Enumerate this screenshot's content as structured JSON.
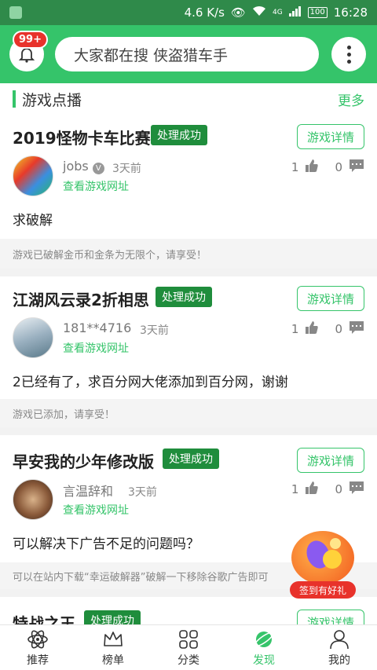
{
  "status_bar": {
    "speed": "4.6 K/s",
    "signal": "4G",
    "battery": "100",
    "time": "16:28"
  },
  "header": {
    "badge": "99+",
    "search_placeholder": "大家都在搜  侠盗猎车手"
  },
  "section": {
    "title": "游戏点播",
    "more": "更多"
  },
  "cards": [
    {
      "game": "2019怪物卡车比赛",
      "status": "处理成功",
      "detail": "游戏详情",
      "user": "jobs",
      "time": "3天前",
      "link": "查看游戏网址",
      "likes": "1",
      "comments": "0",
      "content": "求破解",
      "reply": "游戏已破解金币和金条为无限个，请享受！"
    },
    {
      "game": "江湖风云录2折相思",
      "status": "处理成功",
      "detail": "游戏详情",
      "user": "181**4716",
      "time": "3天前",
      "link": "查看游戏网址",
      "likes": "1",
      "comments": "0",
      "content": "2已经有了，求百分网大佬添加到百分网，谢谢",
      "reply": "游戏已添加，请享受！"
    },
    {
      "game": "早安我的少年修改版",
      "status": "处理成功",
      "detail": "游戏详情",
      "user": "言温辞和",
      "time": "3天前",
      "link": "查看游戏网址",
      "likes": "1",
      "comments": "0",
      "content": "可以解决下广告不足的问题吗？",
      "reply": "可以在站内下载“幸运破解器”破解一下移除谷歌广告即可"
    },
    {
      "game": "特战之王",
      "status": "处理成功",
      "detail": "游戏详情"
    }
  ],
  "gift": {
    "label": "签到有好礼"
  },
  "nav": [
    {
      "label": "推荐",
      "icon": "atom-icon"
    },
    {
      "label": "榜单",
      "icon": "crown-icon"
    },
    {
      "label": "分类",
      "icon": "grid-icon"
    },
    {
      "label": "发现",
      "icon": "planet-icon"
    },
    {
      "label": "我的",
      "icon": "person-icon"
    }
  ]
}
